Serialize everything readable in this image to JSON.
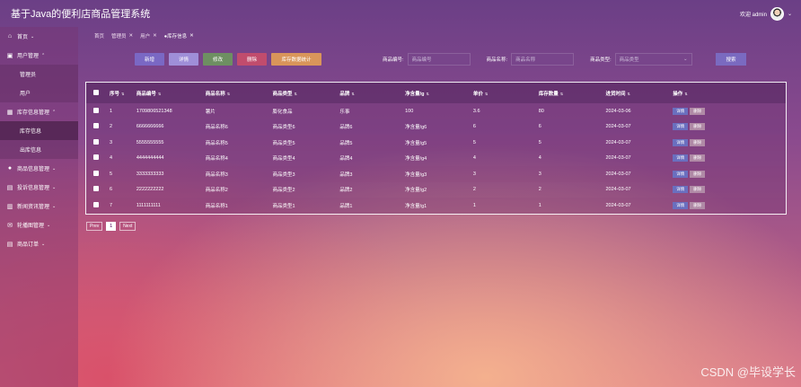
{
  "app": {
    "title": "基于Java的便利店商品管理系统"
  },
  "user": {
    "welcome": "欢迎 admin",
    "chevron": "⌄"
  },
  "sidebar": {
    "items": [
      {
        "label": "首页",
        "icon": "home-icon",
        "glyph": "⌂",
        "arrow": "⌄",
        "sub": false,
        "active": false
      },
      {
        "label": "用户管理",
        "icon": "user-icon",
        "glyph": "▣",
        "arrow": "⌃",
        "sub": false,
        "active": false
      },
      {
        "label": "管理员",
        "sub": true,
        "active": false
      },
      {
        "label": "用户",
        "sub": true,
        "active": false
      },
      {
        "label": "库存信息管理",
        "icon": "inventory-icon",
        "glyph": "▦",
        "arrow": "⌃",
        "sub": false,
        "active": false
      },
      {
        "label": "库存信息",
        "sub": true,
        "active": true
      },
      {
        "label": "出库信息",
        "sub": true,
        "active": false
      },
      {
        "label": "商品信息管理",
        "icon": "goods-icon",
        "glyph": "●",
        "arrow": "⌄",
        "sub": false,
        "active": false
      },
      {
        "label": "投诉信息管理",
        "icon": "complaint-icon",
        "glyph": "▤",
        "arrow": "⌄",
        "sub": false,
        "active": false
      },
      {
        "label": "新闻资讯管理",
        "icon": "news-icon",
        "glyph": "▥",
        "arrow": "⌄",
        "sub": false,
        "active": false
      },
      {
        "label": "轮播图管理",
        "icon": "carousel-icon",
        "glyph": "✉",
        "arrow": "⌄",
        "sub": false,
        "active": false
      },
      {
        "label": "商品订单",
        "icon": "order-icon",
        "glyph": "▤",
        "arrow": "⌄",
        "sub": false,
        "active": false
      }
    ]
  },
  "tabs": [
    {
      "label": "首页",
      "close": ""
    },
    {
      "label": "管理员",
      "close": "✕"
    },
    {
      "label": "用户",
      "close": "✕"
    },
    {
      "label": "●库存信息",
      "close": "✕"
    }
  ],
  "toolbar": {
    "buttons": [
      {
        "label": "新增",
        "color": "#7a68c4",
        "width": 33,
        "name": "add-button"
      },
      {
        "label": "详情",
        "color": "#9f8fd8",
        "width": 33,
        "name": "detail-button"
      },
      {
        "label": "修改",
        "color": "#6e8f62",
        "width": 33,
        "name": "edit-button"
      },
      {
        "label": "删除",
        "color": "#c14c6d",
        "width": 33,
        "name": "delete-button"
      },
      {
        "label": "库存数据统计",
        "color": "#d9955a",
        "width": 56,
        "name": "stats-button"
      }
    ]
  },
  "filters": [
    {
      "label": "商品编号:",
      "placeholder": "商品编号",
      "width": 70,
      "name": "code"
    },
    {
      "label": "商品名称:",
      "placeholder": "商品名称",
      "width": 70,
      "name": "name"
    },
    {
      "label": "商品类型:",
      "placeholder": "商品类型",
      "width": 86,
      "name": "type",
      "select": true
    }
  ],
  "search": {
    "label": "搜索"
  },
  "table": {
    "headers": [
      "序号",
      "商品编号",
      "商品名称",
      "商品类型",
      "品牌",
      "净含量/g",
      "单价",
      "库存数量",
      "进货时间",
      "操作"
    ],
    "rows": [
      [
        "1",
        "1709806521348",
        "薯片",
        "膨化食品",
        "乐事",
        "100",
        "3.6",
        "80",
        "2024-03-06"
      ],
      [
        "2",
        "6666666666",
        "商品名称6",
        "商品类型6",
        "品牌6",
        "净含量/g6",
        "6",
        "6",
        "2024-03-07"
      ],
      [
        "3",
        "5555555555",
        "商品名称5",
        "商品类型5",
        "品牌5",
        "净含量/g5",
        "5",
        "5",
        "2024-03-07"
      ],
      [
        "4",
        "4444444444",
        "商品名称4",
        "商品类型4",
        "品牌4",
        "净含量/g4",
        "4",
        "4",
        "2024-03-07"
      ],
      [
        "5",
        "3333333333",
        "商品名称3",
        "商品类型3",
        "品牌3",
        "净含量/g3",
        "3",
        "3",
        "2024-03-07"
      ],
      [
        "6",
        "2222222222",
        "商品名称2",
        "商品类型2",
        "品牌2",
        "净含量/g2",
        "2",
        "2",
        "2024-03-07"
      ],
      [
        "7",
        "1111111111",
        "商品名称1",
        "商品类型1",
        "品牌1",
        "净含量/g1",
        "1",
        "1",
        "2024-03-07"
      ]
    ],
    "actions": {
      "detail": "详情",
      "delete": "删除"
    }
  },
  "pager": {
    "prev": "Prev",
    "current": "1",
    "next": "Next"
  },
  "watermark": "CSDN @毕设学长"
}
